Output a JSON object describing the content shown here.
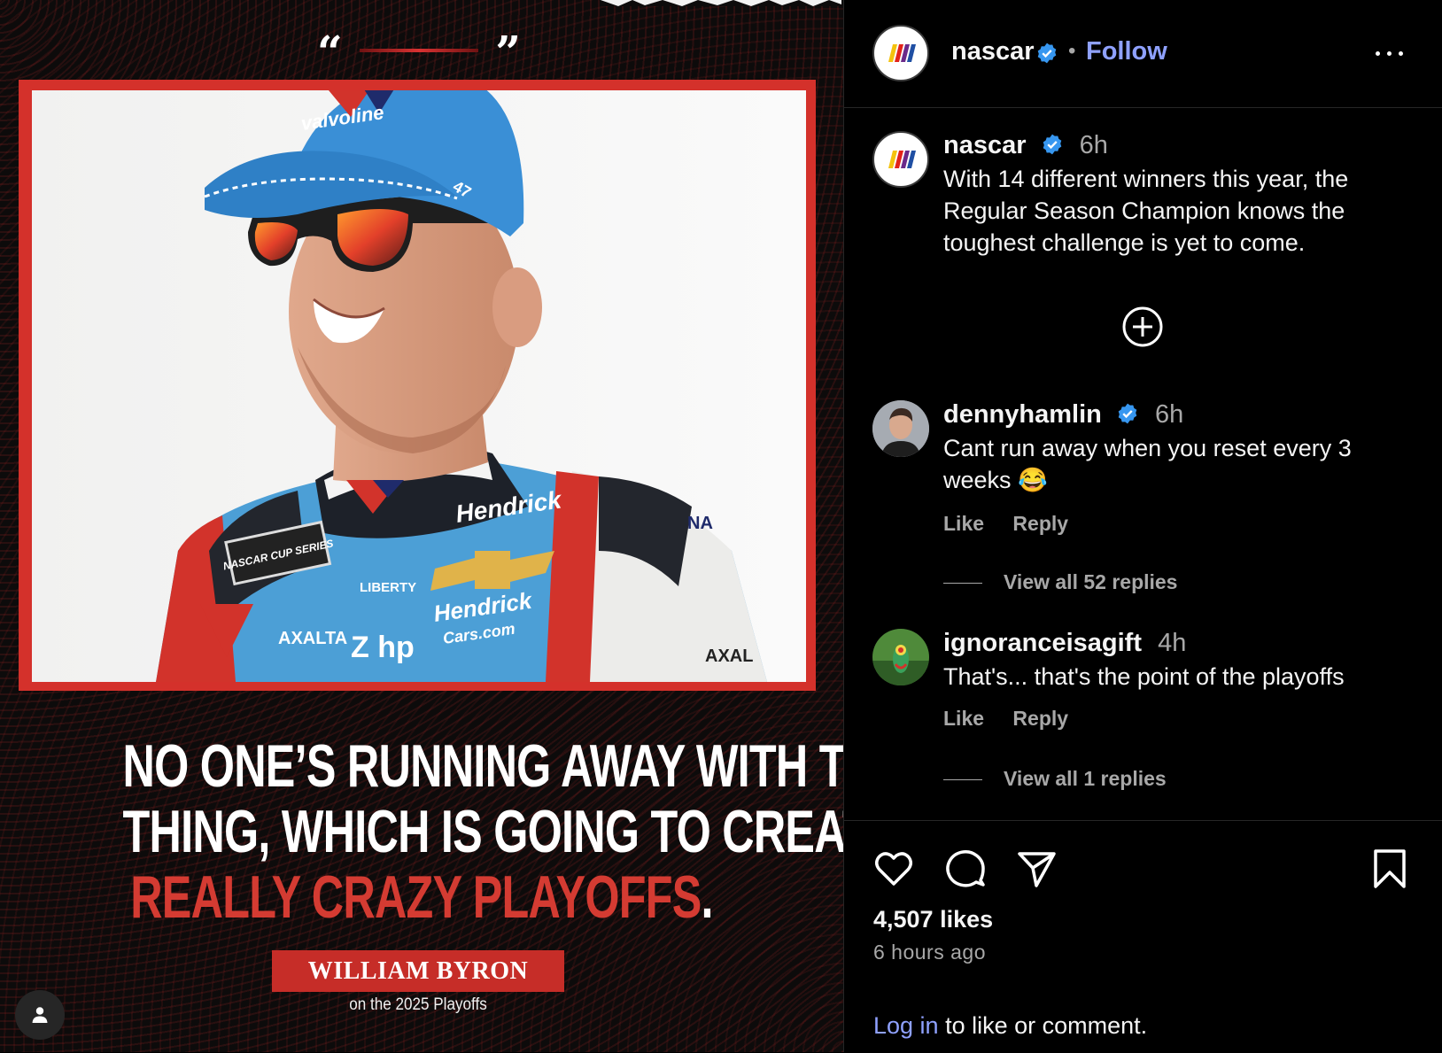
{
  "post": {
    "headline_line1": "NO ONE’S RUNNING AWAY WITH THIS",
    "headline_line2": "THING, WHICH IS GOING TO CREATE A",
    "headline_red": "REALLY CRAZY PLAYOFFS",
    "headline_period": ".",
    "quote_open": "“",
    "quote_close": "”",
    "name_plate": "WILLIAM BYRON",
    "name_caption": "on the 2025 Playoffs",
    "cap_brand": "valvoline",
    "cap_number": "47",
    "suit_sponsor1": "Hendrick",
    "suit_sponsor2": "Hendrick",
    "suit_sponsor2_sub": "Cars.com",
    "suit_patch": "NASCAR CUP SERIES",
    "suit_liberty": "LIBERTY",
    "suit_axalta": "AXALTA",
    "suit_axalta_right": "AXAL",
    "suit_hp": "Z hp",
    "suit_shoulder": "NA",
    "accent_red": "#c62d28",
    "user_tag_icon": "person-icon"
  },
  "header": {
    "username": "nascar",
    "separator": "•",
    "follow": "Follow",
    "verified_icon": "verified-badge-icon",
    "more_icon": "more-options-icon"
  },
  "caption": {
    "username": "nascar",
    "time": "6h",
    "text": "With 14 different winners this year, the Regular Season Champion knows the toughest challenge is yet to come."
  },
  "comments": [
    {
      "username": "dennyhamlin",
      "verified": true,
      "time": "6h",
      "text": "Cant run away when you reset every 3 weeks 😂",
      "like": "Like",
      "reply": "Reply",
      "view_replies": "View all 52 replies"
    },
    {
      "username": "ignoranceisagift",
      "verified": false,
      "time": "4h",
      "text": "That's... that's the point of the playoffs",
      "like": "Like",
      "reply": "Reply",
      "view_replies": "View all 1 replies"
    }
  ],
  "actions": {
    "likes": "4,507 likes",
    "time_ago": "6 hours ago",
    "login_link": "Log in",
    "login_rest": " to like or comment."
  },
  "colors": {
    "link_blue": "#8fa1ff",
    "verified_blue": "#3797f0",
    "muted_text": "#a8a8a8",
    "divider": "#262626"
  }
}
